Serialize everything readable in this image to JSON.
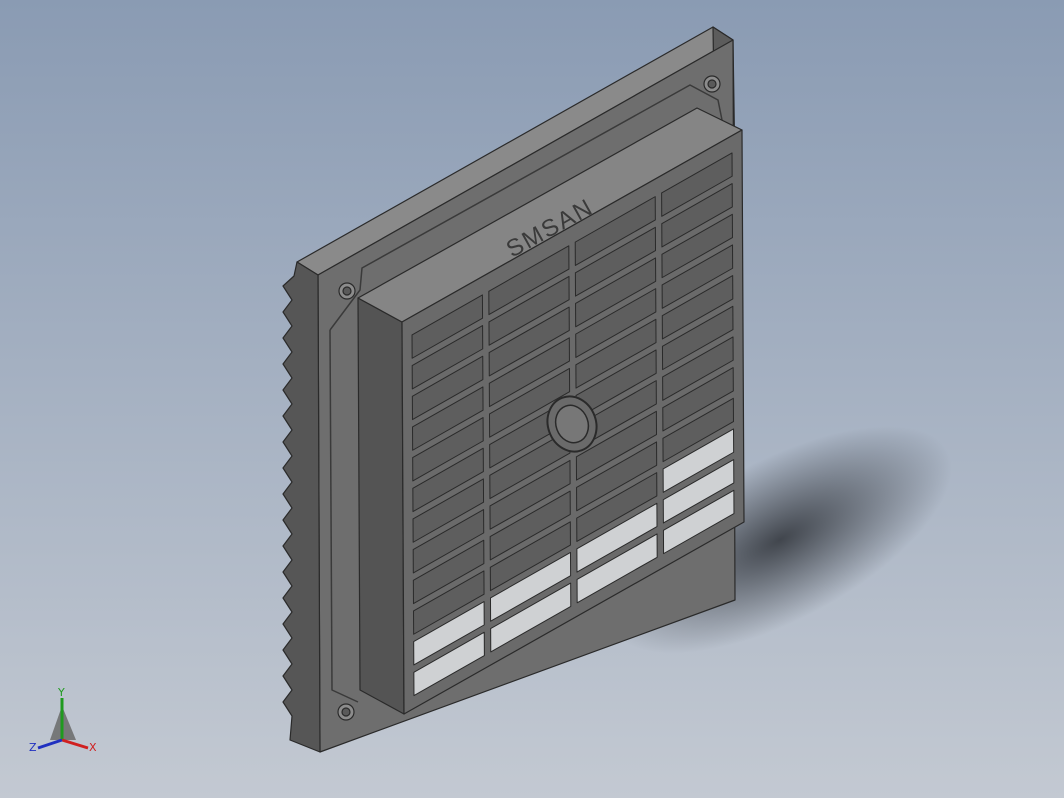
{
  "model": {
    "logo_text": "SMSAN",
    "colors": {
      "background_top": "#8a9bb3",
      "background_bottom": "#c3c9d2",
      "front_face": "#6b6b6b",
      "side_face": "#4f4f4f",
      "top_face": "#7d7d7d",
      "edge": "#2a2a2a",
      "slot_opening": "#cfd1d3"
    }
  },
  "triad": {
    "x_label": "X",
    "y_label": "Y",
    "z_label": "Z",
    "x_color": "#d02020",
    "y_color": "#1f9a1f",
    "z_color": "#2030c0"
  }
}
